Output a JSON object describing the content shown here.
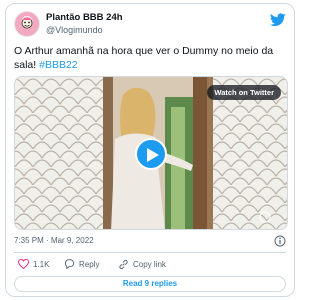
{
  "account": {
    "display_name": "Plantão BBB 24h",
    "handle": "@Vlogimundo",
    "avatar_icon": "cartoon-character-avatar"
  },
  "platform_icon": "twitter-bird-icon",
  "tweet": {
    "text_before": "O Arthur amanhã na hora que ver o Dummy no meio da sala! ",
    "hashtag": "#BBB22"
  },
  "media": {
    "watch_label": "Watch on Twitter",
    "play_icon": "play-icon",
    "watermark_icon": "globoplay-watermark-icon"
  },
  "meta": {
    "timestamp": "7:35 PM · Mar 9, 2022",
    "info_icon": "info-icon"
  },
  "actions": {
    "like_count": "1.1K",
    "reply_label": "Reply",
    "copy_label": "Copy link"
  },
  "read_replies_label": "Read 9 replies",
  "colors": {
    "accent": "#1d9bf0",
    "like_red": "#f91880",
    "text": "#0f1419",
    "muted": "#536471",
    "border": "#cfd9de"
  }
}
